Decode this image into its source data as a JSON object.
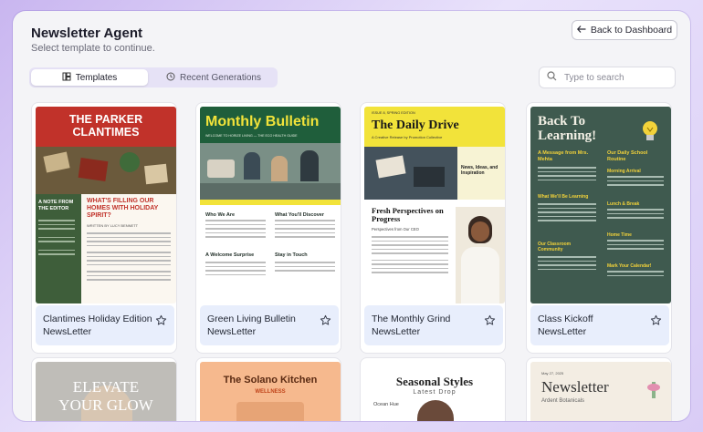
{
  "header": {
    "title": "Newsletter Agent",
    "subtitle": "Select template to continue.",
    "back_label": "Back to Dashboard"
  },
  "tabs": [
    {
      "label": "Templates",
      "active": true,
      "icon": "templates-icon"
    },
    {
      "label": "Recent Generations",
      "active": false,
      "icon": "history-icon"
    }
  ],
  "search": {
    "placeholder": "Type to search"
  },
  "templates": [
    {
      "name": "Clantimes Holiday Edition",
      "type": "NewsLetter",
      "thumb": {
        "masthead": "THE PARKER CLANTIMES",
        "side_heading": "A NOTE FROM THE EDITOR",
        "headline": "WHAT'S FILLING OUR HOMES WITH HOLIDAY SPIRIT?",
        "byline": "WRITTEN BY LUCY BENNETT"
      }
    },
    {
      "name": "Green Living Bulletin",
      "type": "NewsLetter",
      "thumb": {
        "masthead": "Monthly Bulletin",
        "tagline": "WELCOME TO HORIZE LIVING — THE ECO HEALTH GUIDE",
        "sections": [
          "Who We Are",
          "What You'll Discover",
          "A Welcome Surprise",
          "Stay in Touch"
        ]
      }
    },
    {
      "name": "The Monthly Grind",
      "type": "NewsLetter",
      "thumb": {
        "edition": "ISSUE 8, SPRING EDITION",
        "masthead": "The Daily Drive",
        "tagline": "A Creative Release by Promotion Collective",
        "side": "News, Ideas, and Inspiration",
        "headline": "Fresh Perspectives on Progress",
        "subhead": "Perspectives from Our CEO"
      }
    },
    {
      "name": "Class Kickoff",
      "type": "NewsLetter",
      "thumb": {
        "masthead": "Back To Learning!",
        "left_title": "A Message from Mrs. Mehta",
        "left_sections": [
          "What We'll Be Learning",
          "Our Classroom Community"
        ],
        "right_title": "Our Daily School Routine",
        "right_sections": [
          "Morning Arrival",
          "Lunch & Break",
          "Home Time",
          "Mark Your Calendar!"
        ]
      }
    }
  ],
  "partial_row": [
    {
      "text_line1": "ELEVATE",
      "text_line2": "YOUR GLOW"
    },
    {
      "title": "The Solano Kitchen",
      "subtitle": "WELLNESS"
    },
    {
      "title": "Seasonal Styles",
      "subtitle": "Latest Drop",
      "caption": "Ocean Hue"
    },
    {
      "title": "Newsletter",
      "subtitle": "Ardent Botanicals",
      "date": "May 27, 2025"
    }
  ],
  "colors": {
    "accent": "#6c5ce7",
    "card_footer": "#e8eefc",
    "clantimes_red": "#c1322a",
    "bulletin_green": "#1f5e3b",
    "daily_yellow": "#f2e33a",
    "class_green": "#3f5a4f"
  }
}
